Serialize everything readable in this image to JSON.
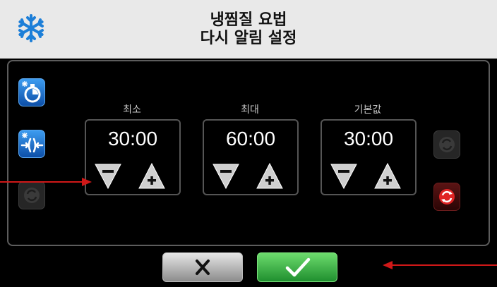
{
  "header": {
    "line1": "냉찜질 요법",
    "line2": "다시 알림 설정"
  },
  "columns": [
    {
      "label": "최소",
      "value": "30:00"
    },
    {
      "label": "최대",
      "value": "60:00"
    },
    {
      "label": "기본값",
      "value": "30:00"
    }
  ],
  "icons": {
    "header": "snowflake-icon",
    "left_top": "cold-timer-icon",
    "left_middle": "cold-compress-icon",
    "left_bottom": "refresh-disabled-icon",
    "right_top": "refresh-disabled-icon",
    "right_bottom": "refresh-red-icon",
    "minus": "minus-icon",
    "plus": "plus-icon",
    "cancel": "close-icon",
    "confirm": "checkmark-icon"
  },
  "colors": {
    "accent_blue": "#1f6fd1",
    "confirm_green": "#2aa83a",
    "reset_red": "#d42020",
    "annotation_red": "#d01818"
  }
}
